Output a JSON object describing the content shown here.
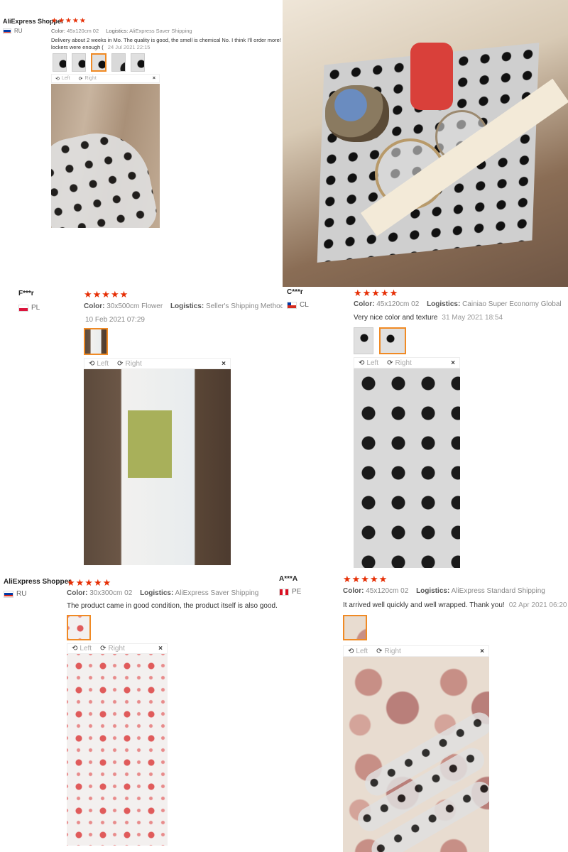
{
  "reviews": [
    {
      "user": "AliExpress Shopper",
      "country": "RU",
      "stars": "★★★★★",
      "color_label": "Color:",
      "color_value": "45x120cm 02",
      "logistics_label": "Logistics:",
      "logistics_value": "AliExpress Saver Shipping",
      "text": "Delivery about 2 weeks in Mo. The quality is good, the smell is chemical No. I think I'll order more!",
      "text2": "lockers were enough (",
      "date": "24 Jul 2021 22:15",
      "viewer_left": "Left",
      "viewer_right": "Right",
      "viewer_close": "×"
    },
    {
      "user": "F***r",
      "country": "PL",
      "stars": "★★★★★",
      "color_label": "Color:",
      "color_value": "30x500cm Flower",
      "logistics_label": "Logistics:",
      "logistics_value": "Seller's Shipping Method",
      "date": "10 Feb 2021 07:29",
      "viewer_left": "Left",
      "viewer_right": "Right",
      "viewer_close": "×"
    },
    {
      "user": "C***r",
      "country": "CL",
      "stars": "★★★★★",
      "color_label": "Color:",
      "color_value": "45x120cm 02",
      "logistics_label": "Logistics:",
      "logistics_value": "Cainiao Super Economy Global",
      "text": "Very nice color and texture",
      "date": "31 May 2021 18:54",
      "viewer_left": "Left",
      "viewer_right": "Right",
      "viewer_close": "×"
    },
    {
      "user": "AliExpress Shopper",
      "country": "RU",
      "stars": "★★★★★",
      "color_label": "Color:",
      "color_value": "30x300cm 02",
      "logistics_label": "Logistics:",
      "logistics_value": "AliExpress Saver Shipping",
      "text": "The product came in good condition, the product itself is also good. (",
      "viewer_left": "Left",
      "viewer_right": "Right",
      "viewer_close": "×"
    },
    {
      "user": "A***A",
      "country": "PE",
      "stars": "★★★★★",
      "color_label": "Color:",
      "color_value": "45x120cm 02",
      "logistics_label": "Logistics:",
      "logistics_value": "AliExpress Standard Shipping",
      "text": "It arrived well quickly and well wrapped. Thank you!",
      "date": "02 Apr 2021 06:20",
      "viewer_left": "Left",
      "viewer_right": "Right",
      "viewer_close": "×"
    }
  ],
  "colors": {
    "star": "#e62e04",
    "active_thumb": "#f08a24"
  },
  "icons": {
    "rotate_left": "rotate-left-icon",
    "rotate_right": "rotate-right-icon",
    "close": "close-icon"
  }
}
